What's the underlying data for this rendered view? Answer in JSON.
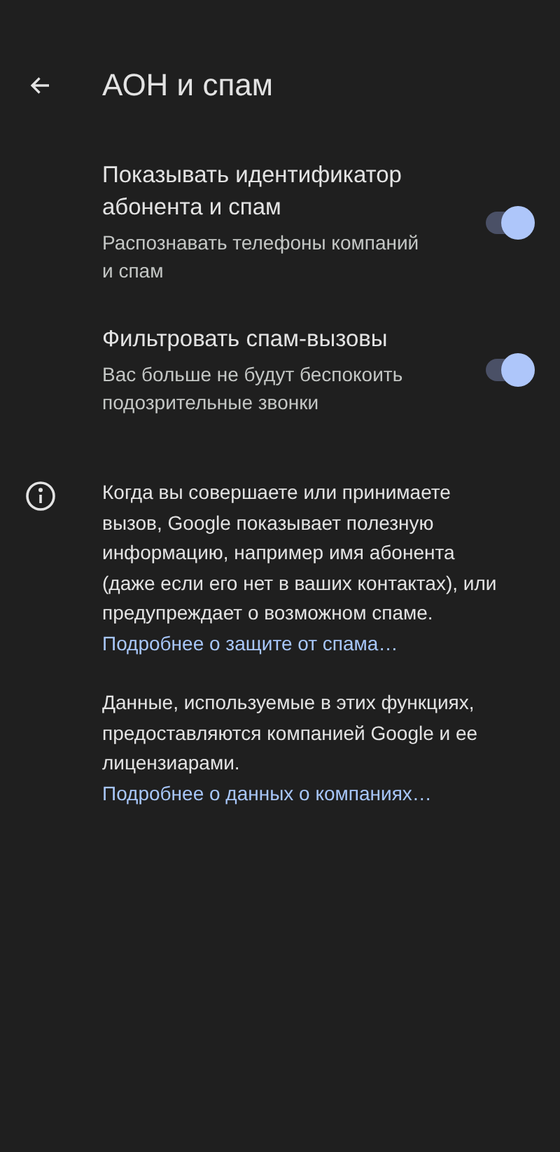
{
  "header": {
    "title": "АОН и спам"
  },
  "settings": [
    {
      "title": "Показывать идентификатор абонента и спам",
      "subtitle": "Распознавать телефоны компаний и спам",
      "on": true
    },
    {
      "title": "Фильтровать спам-вызовы",
      "subtitle": "Вас больше не будут беспокоить подозрительные звонки",
      "on": true
    }
  ],
  "info": {
    "paragraphs": [
      {
        "text": "Когда вы совершаете или принимаете вызов, Google показывает полезную информацию, например имя абонента (даже если его нет в ваших контактах), или предупреждает о возможном спаме.",
        "link": "Подробнее о защите от спама…"
      },
      {
        "text": "Данные, используемые в этих функциях, предоставляются компанией Google и ее лицензиарами.",
        "link": "Подробнее о данных о компаниях…"
      }
    ]
  }
}
